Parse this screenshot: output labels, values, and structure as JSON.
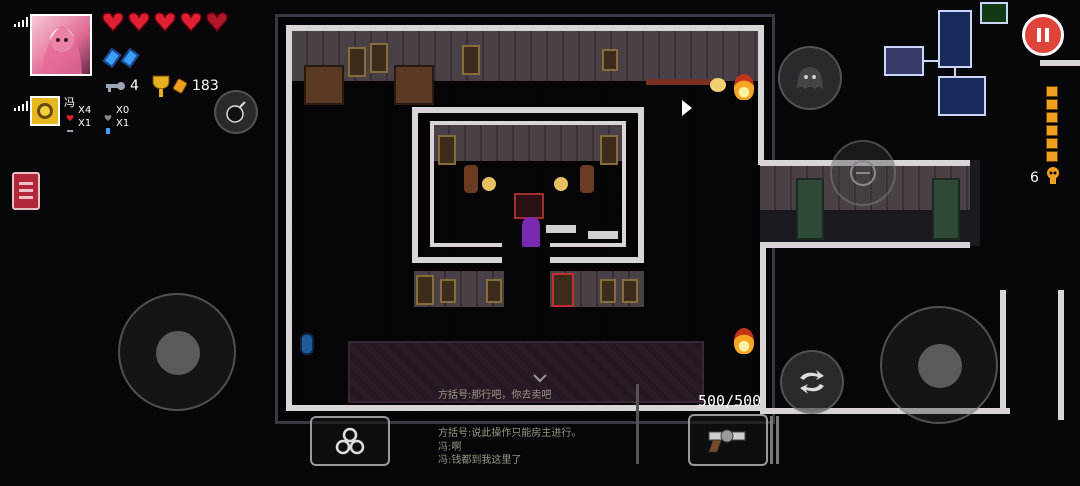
{
  "player1": {
    "hearts_full": 4,
    "hearts_partial": 1,
    "blanks": 2,
    "keys": "4",
    "shells": "183",
    "signal_icon": "signal-bars-icon"
  },
  "player2": {
    "name": "冯",
    "stat1": "X4",
    "stat2": "X0",
    "stat3": "X1",
    "stat4": "X1"
  },
  "weapon": {
    "ammo": "500/500"
  },
  "ammo_side": {
    "count": "6"
  },
  "chat": {
    "lines": [
      "方括号:那行吧，你去卖吧",
      "方括号:说此操作只能房主进行。",
      "冯:啊",
      "冯:钱都到我这里了"
    ]
  },
  "colors": {
    "pause": "#e0433a",
    "heart": "#e02030",
    "blank": "#3aa0ff",
    "shell": "#f0a020"
  }
}
